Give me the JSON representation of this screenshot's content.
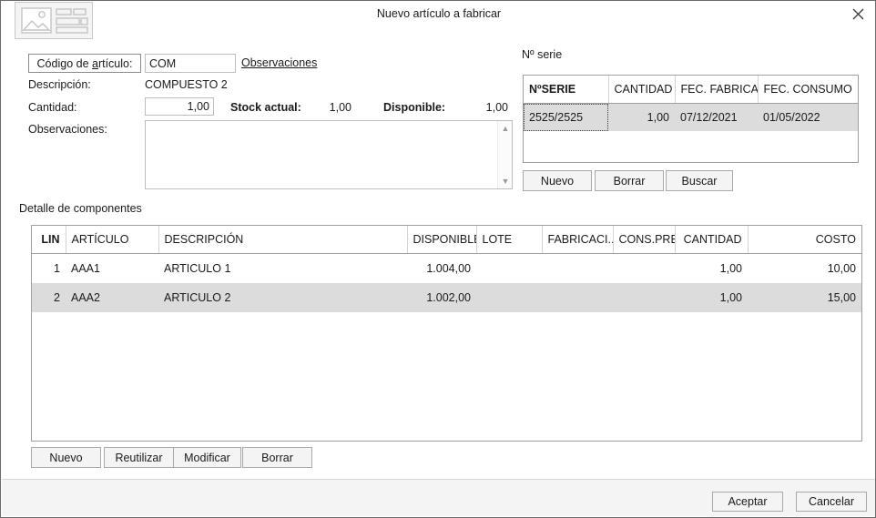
{
  "window": {
    "title": "Nuevo artículo a fabricar",
    "app_icon": "image-form-icon",
    "close_label": "✕"
  },
  "form": {
    "codigo_label": "Código de artículo:",
    "codigo_accel": "a",
    "codigo_value": "COM",
    "observaciones_link": "Observaciones",
    "descripcion_label": "Descripción:",
    "descripcion_value": "COMPUESTO 2",
    "cantidad_label": "Cantidad:",
    "cantidad_value": "1,00",
    "stock_label": "Stock actual:",
    "stock_value": "1,00",
    "disponible_label": "Disponible:",
    "disponible_value": "1,00",
    "observaciones_label": "Observaciones:",
    "observaciones_value": "",
    "observaciones_placeholder": ""
  },
  "serie": {
    "section_label": "Nº serie",
    "columns": [
      "NºSERIE",
      "CANTIDAD",
      "FEC. FABRICA...",
      "FEC. CONSUMO"
    ],
    "rows": [
      {
        "nserie": "2525/2525",
        "cantidad": "1,00",
        "fec_fabricacion": "07/12/2021",
        "fec_consumo": "01/05/2022",
        "selected": true
      }
    ],
    "buttons": [
      "Nuevo",
      "Borrar",
      "Buscar"
    ]
  },
  "detalle": {
    "section_label": "Detalle de componentes",
    "columns": [
      "LIN",
      "ARTÍCULO",
      "DESCRIPCIÓN",
      "DISPONIBLE",
      "LOTE",
      "FABRICACI...",
      "CONS.PREF.",
      "CANTIDAD",
      "COSTO"
    ],
    "rows": [
      {
        "lin": "1",
        "articulo": "AAA1",
        "descripcion": "ARTICULO 1",
        "disponible": "1.004,00",
        "lote": "",
        "fabricacion": "",
        "cons_pref": "",
        "cantidad": "1,00",
        "costo": "10,00",
        "selected": false
      },
      {
        "lin": "2",
        "articulo": "AAA2",
        "descripcion": "ARTICULO 2",
        "disponible": "1.002,00",
        "lote": "",
        "fabricacion": "",
        "cons_pref": "",
        "cantidad": "1,00",
        "costo": "15,00",
        "selected": true
      }
    ],
    "buttons": [
      "Nuevo",
      "Reutilizar",
      "Modificar",
      "Borrar"
    ]
  },
  "footer": {
    "accept_label": "Aceptar",
    "cancel_label": "Cancelar"
  },
  "colors": {
    "window_border": "#6b6b6b",
    "button_face": "#f4f4f4",
    "button_border": "#a8a8a8",
    "grid_border": "#a0a0a0",
    "row_selected": "#dcdcdc",
    "text": "#1a1a1a",
    "footer_bg": "#f4f4f4"
  }
}
